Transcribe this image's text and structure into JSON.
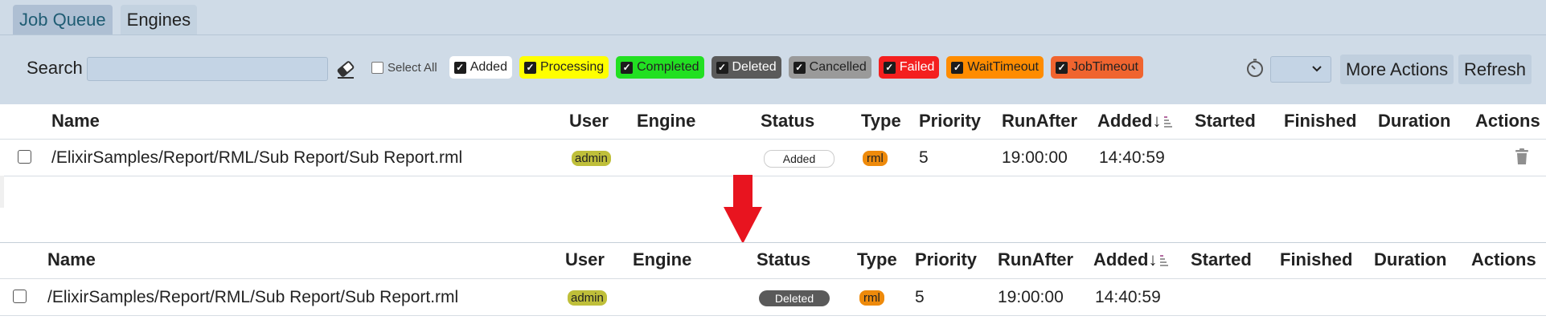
{
  "tabs": [
    "Job Queue",
    "Engines"
  ],
  "toolbar": {
    "search_label": "Search",
    "search_placeholder": "",
    "select_all_label": "Select All",
    "more_actions_label": "More Actions",
    "refresh_label": "Refresh"
  },
  "filters": [
    {
      "label": "Added",
      "checked": true,
      "bg": "#ffffff",
      "color": "#222222"
    },
    {
      "label": "Processing",
      "checked": true,
      "bg": "#ffff00",
      "color": "#222222"
    },
    {
      "label": "Completed",
      "checked": true,
      "bg": "#22e022",
      "color": "#222222"
    },
    {
      "label": "Deleted",
      "checked": true,
      "bg": "#5a5a5a",
      "color": "#ffffff"
    },
    {
      "label": "Cancelled",
      "checked": true,
      "bg": "#9a9a9a",
      "color": "#222222"
    },
    {
      "label": "Failed",
      "checked": true,
      "bg": "#f41f1f",
      "color": "#ffffff"
    },
    {
      "label": "WaitTimeout",
      "checked": true,
      "bg": "#ff8c00",
      "color": "#222222"
    },
    {
      "label": "JobTimeout",
      "checked": true,
      "bg": "#f0642f",
      "color": "#222222"
    }
  ],
  "table": {
    "columns": [
      "Name",
      "User",
      "Engine",
      "Status",
      "Type",
      "Priority",
      "RunAfter",
      "Added↓",
      "Started",
      "Finished",
      "Duration",
      "Actions"
    ]
  },
  "before": {
    "name": "/ElixirSamples/Report/RML/Sub Report/Sub Report.rml",
    "user": "admin",
    "engine": "",
    "status": "Added",
    "type": "rml",
    "priority": "5",
    "run_after": "19:00:00",
    "added": "14:40:59",
    "started": "",
    "finished": "",
    "duration": ""
  },
  "after": {
    "name": "/ElixirSamples/Report/RML/Sub Report/Sub Report.rml",
    "user": "admin",
    "engine": "",
    "status": "Deleted",
    "type": "rml",
    "priority": "5",
    "run_after": "19:00:00",
    "added": "14:40:59",
    "started": "",
    "finished": "",
    "duration": ""
  },
  "colors": {
    "toolbar_bg": "#cfdbe7",
    "arrow": "#e8141f",
    "user_badge": "#bfbf3a",
    "type_badge": "#ee8a0b"
  },
  "icons": {
    "eraser": "eraser-icon",
    "timer": "timer-icon",
    "trash": "trash-icon",
    "sort": "sort-descending-icon",
    "arrow": "down-arrow-icon"
  }
}
